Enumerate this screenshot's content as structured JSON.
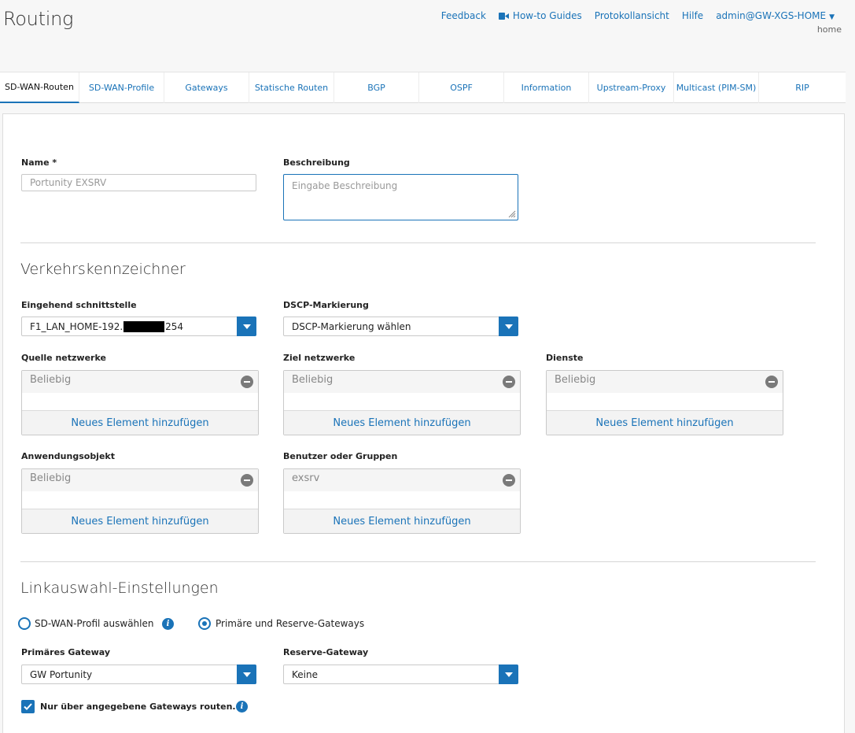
{
  "header": {
    "title": "Routing",
    "links": {
      "feedback": "Feedback",
      "howto": "How-to Guides",
      "log": "Protokollansicht",
      "help": "Hilfe",
      "user": "admin@GW-XGS-HOME"
    },
    "user_sub": "home"
  },
  "tabs": [
    "SD-WAN-Routen",
    "SD-WAN-Profile",
    "Gateways",
    "Statische Routen",
    "BGP",
    "OSPF",
    "Information",
    "Upstream-Proxy",
    "Multicast (PIM-SM)",
    "RIP"
  ],
  "active_tab": 0,
  "form": {
    "name_label": "Name *",
    "name_value": "Portunity EXSRV",
    "desc_label": "Beschreibung",
    "desc_placeholder": "Eingabe Beschreibung",
    "section_traffic": "Verkehrskennzeichner",
    "incoming_label": "Eingehend schnittstelle",
    "incoming_value": "F1_LAN_HOME-192.",
    "incoming_value_end": "254",
    "dscp_label": "DSCP-Markierung",
    "dscp_value": "DSCP-Markierung wählen",
    "lists": [
      {
        "label": "Quelle netzwerke",
        "value": "Beliebig",
        "add": "Neues Element hinzufügen"
      },
      {
        "label": "Ziel netzwerke",
        "value": "Beliebig",
        "add": "Neues Element hinzufügen"
      },
      {
        "label": "Dienste",
        "value": "Beliebig",
        "add": "Neues Element hinzufügen"
      },
      {
        "label": "Anwendungsobjekt",
        "value": "Beliebig",
        "add": "Neues Element hinzufügen"
      },
      {
        "label": "Benutzer oder Gruppen",
        "value": "exsrv",
        "add": "Neues Element hinzufügen"
      }
    ],
    "section_link": "Linkauswahl-Einstellungen",
    "radio_profile": "SD-WAN-Profil auswählen",
    "radio_gateways": "Primäre und Reserve-Gateways",
    "primary_label": "Primäres Gateway",
    "primary_value": "GW Portunity",
    "backup_label": "Reserve-Gateway",
    "backup_value": "Keine",
    "only_route_label": "Nur über angegebene Gateways routen."
  },
  "colors": {
    "accent": "#1a73b8"
  }
}
